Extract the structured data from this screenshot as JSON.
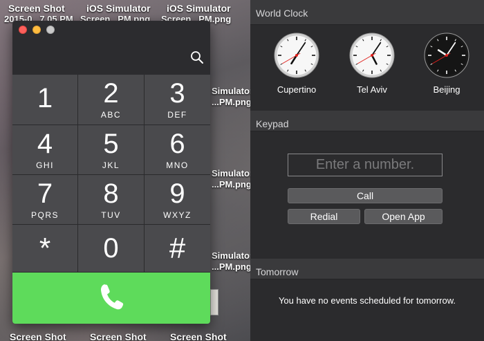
{
  "desktop": {
    "top_labels": [
      "Screen Shot",
      "iOS Simulator",
      "iOS Simulator"
    ],
    "top_sublabels": [
      "2015-0...7.05 PM",
      "Screen...PM.png",
      "Screen...PM.png"
    ],
    "side_labels": [
      {
        "a": "Screen Shot",
        "b": "2015-0..."
      },
      {
        "a": "iOS Simulator",
        "b": "Screen...PM.png"
      }
    ],
    "mid_labels_right": [
      "Simulator",
      "...PM.png",
      "Simulator",
      "...PM.png",
      "Simulator",
      "...PM.png"
    ],
    "bottom_labels": [
      "Screen Shot",
      "Screen Shot",
      "Screen Shot"
    ]
  },
  "simulator": {
    "keys": [
      {
        "digit": "1",
        "letters": ""
      },
      {
        "digit": "2",
        "letters": "ABC"
      },
      {
        "digit": "3",
        "letters": "DEF"
      },
      {
        "digit": "4",
        "letters": "GHI"
      },
      {
        "digit": "5",
        "letters": "JKL"
      },
      {
        "digit": "6",
        "letters": "MNO"
      },
      {
        "digit": "7",
        "letters": "PQRS"
      },
      {
        "digit": "8",
        "letters": "TUV"
      },
      {
        "digit": "9",
        "letters": "WXYZ"
      },
      {
        "digit": "*",
        "letters": ""
      },
      {
        "digit": "0",
        "letters": ""
      },
      {
        "digit": "#",
        "letters": ""
      }
    ],
    "call_color": "#5edb5b",
    "icons": {
      "search": "search-icon",
      "call": "phone-icon"
    }
  },
  "notification_center": {
    "world_clock": {
      "title": "World Clock",
      "clocks": [
        {
          "city": "Cupertino",
          "hour": 7,
          "minute": 5,
          "second": 40,
          "face": "light"
        },
        {
          "city": "Tel Aviv",
          "hour": 5,
          "minute": 5,
          "second": 40,
          "face": "light"
        },
        {
          "city": "Beijing",
          "hour": 10,
          "minute": 5,
          "second": 40,
          "face": "dark"
        }
      ]
    },
    "keypad": {
      "title": "Keypad",
      "input_placeholder": "Enter a number.",
      "input_value": "",
      "call_label": "Call",
      "redial_label": "Redial",
      "open_app_label": "Open App"
    },
    "tomorrow": {
      "title": "Tomorrow",
      "message": "You have no events scheduled for tomorrow."
    }
  }
}
